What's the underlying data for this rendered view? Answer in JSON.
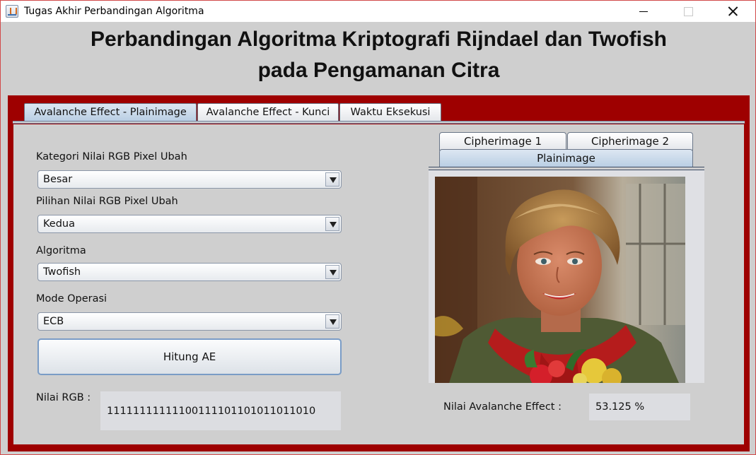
{
  "window": {
    "title": "Tugas Akhir Perbandingan Algoritma"
  },
  "header": {
    "line1": "Perbandingan Algoritma Kriptografi Rijndael dan Twofish",
    "line2": "pada Pengamanan Citra"
  },
  "tabs": [
    "Avalanche Effect - Plainimage",
    "Avalanche Effect - Kunci",
    "Waktu Eksekusi"
  ],
  "form": {
    "kategori_label": "Kategori Nilai RGB Pixel Ubah",
    "kategori_value": "Besar",
    "pilihan_label": "Pilihan Nilai RGB Pixel Ubah",
    "pilihan_value": "Kedua",
    "algoritma_label": "Algoritma",
    "algoritma_value": "Twofish",
    "mode_label": "Mode Operasi",
    "mode_value": "ECB",
    "button_label": "Hitung AE",
    "rgb_label": "Nilai RGB :",
    "rgb_value": "111111111111001111011010110110 10"
  },
  "image_tabs": {
    "top": [
      "Cipherimage 1",
      "Cipherimage 2"
    ],
    "bottom": "Plainimage"
  },
  "result": {
    "label": "Nilai Avalanche Effect :",
    "value": "53.125 %"
  },
  "colors": {
    "frame": "#9e0000",
    "background": "#cfcfcf",
    "tab_active": "#c8d8ea"
  }
}
